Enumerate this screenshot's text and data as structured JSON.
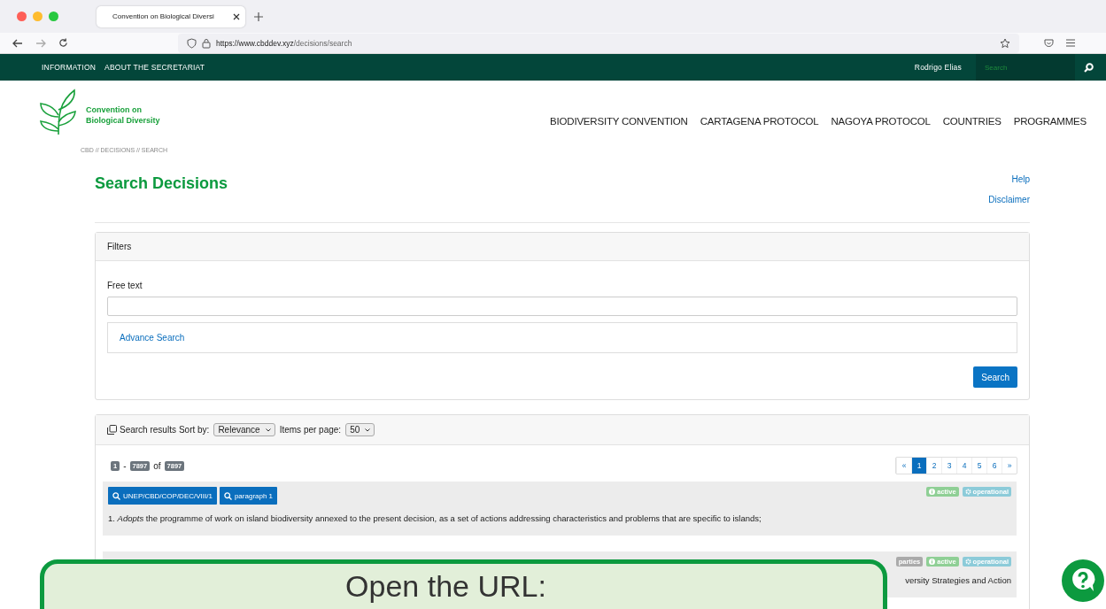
{
  "browser": {
    "tab_title": "Convention on Biological Diversi",
    "url_host": "https://www.cbddev.xyz",
    "url_path": "/decisions/search"
  },
  "topbar": {
    "links": [
      "INFORMATION",
      "ABOUT THE SECRETARIAT"
    ],
    "user": "Rodrigo Elias",
    "search_placeholder": "Search"
  },
  "logo": {
    "line_1": "Convention on",
    "line_2": "Biological Diversity"
  },
  "main_nav": [
    "BIODIVERSITY CONVENTION",
    "CARTAGENA PROTOCOL",
    "NAGOYA PROTOCOL",
    "COUNTRIES",
    "PROGRAMMES"
  ],
  "breadcrumb": "CBD // DECISIONS // SEARCH",
  "title": "Search Decisions",
  "side_links": [
    "Help",
    "Disclaimer"
  ],
  "filters": {
    "header": "Filters",
    "free_text_label": "Free text",
    "advance_search": "Advance Search",
    "search_button": "Search"
  },
  "results": {
    "title": "Search results",
    "sort_label": "Sort by:",
    "sort_value": "Relevance",
    "items_label": "Items per page:",
    "items_value": "50",
    "range": {
      "from": "1",
      "separator": "-",
      "to": "7897",
      "of": "of",
      "total": "7897"
    },
    "pagination": [
      {
        "label": "«",
        "selected": false
      },
      {
        "label": "1",
        "selected": true
      },
      {
        "label": "2",
        "selected": false
      },
      {
        "label": "3",
        "selected": false
      },
      {
        "label": "4",
        "selected": false
      },
      {
        "label": "5",
        "selected": false
      },
      {
        "label": "6",
        "selected": false
      },
      {
        "label": "»",
        "selected": false
      }
    ],
    "items": [
      {
        "buttons": [
          "UNEP/CBD/COP/DEC/VIII/1",
          "paragraph 1"
        ],
        "badges": [
          {
            "label": "active",
            "kind": "active"
          },
          {
            "label": "operational",
            "kind": "operational"
          }
        ],
        "text": "1. *Adopts* the programme of work on island biodiversity annexed to the present decision, as a set of actions addressing characteristics and problems that are specific to islands;"
      },
      {
        "badges": [
          {
            "label": "parties",
            "kind": "parties"
          },
          {
            "label": "active",
            "kind": "active"
          },
          {
            "label": "operational",
            "kind": "operational"
          }
        ],
        "text": "versity Strategies and Action"
      }
    ]
  },
  "callout": {
    "text": "Open the URL:"
  }
}
